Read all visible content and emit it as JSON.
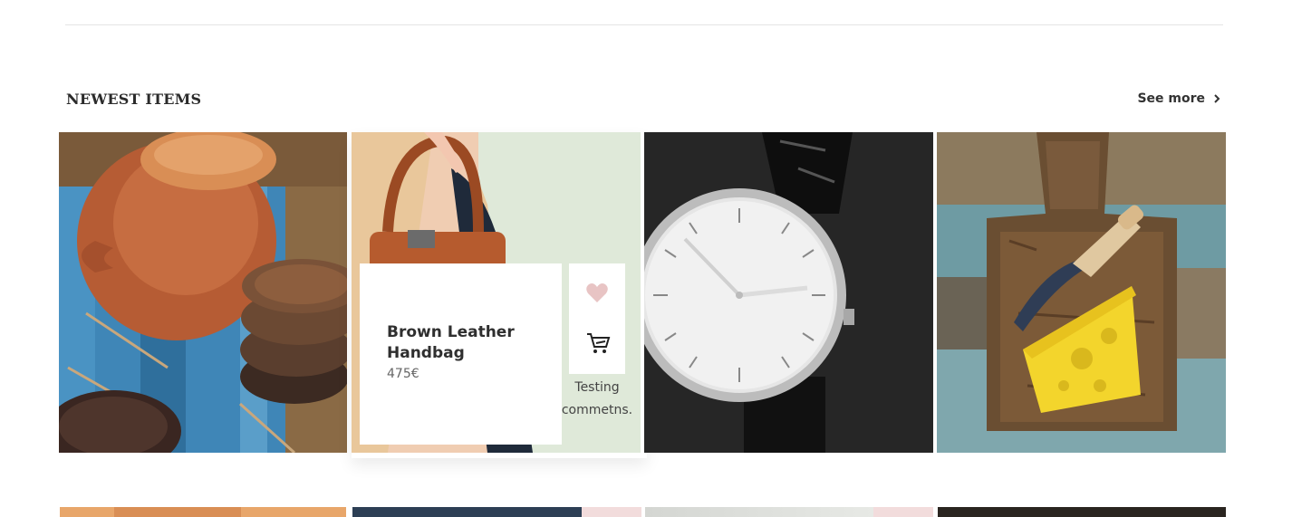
{
  "section": {
    "title": "NEWEST ITEMS",
    "see_more_label": "See more",
    "see_more_icon": "chevron-right-icon"
  },
  "items": [
    {
      "image": "clay-pots-photo"
    },
    {
      "image": "brown-leather-handbag-photo",
      "name": "Brown Leather Handbag",
      "price": "475€",
      "favorite_icon": "heart-icon",
      "cart_icon": "shopping-cart-icon",
      "comment": "Testing commetns."
    },
    {
      "image": "wrist-watch-photo"
    },
    {
      "image": "cheese-board-photo"
    }
  ],
  "colors": {
    "heart": "#e8c4c4",
    "title": "#2b2b2b",
    "divider": "#e4e4e4"
  }
}
